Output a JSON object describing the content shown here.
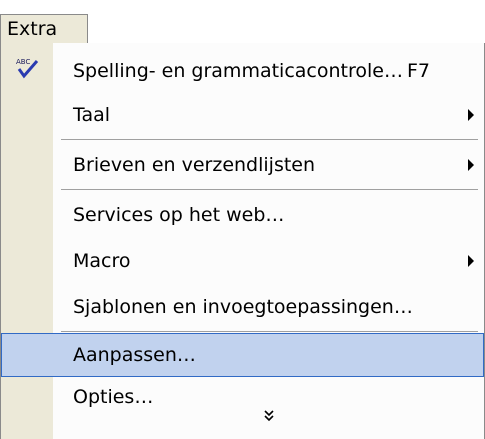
{
  "menubar": {
    "tab_label": "Extra"
  },
  "menu": {
    "items": [
      {
        "label": "Spelling- en grammaticacontrole…",
        "shortcut": "F7",
        "icon": "spellcheck-abc-icon",
        "submenu": false
      },
      {
        "label": "Taal",
        "shortcut": "",
        "submenu": true
      },
      {
        "label": "Brieven en verzendlijsten",
        "shortcut": "",
        "submenu": true
      },
      {
        "label": "Services op het web…",
        "shortcut": "",
        "submenu": false
      },
      {
        "label": "Macro",
        "shortcut": "",
        "submenu": true
      },
      {
        "label": "Sjablonen en invoegtoepassingen…",
        "shortcut": "",
        "submenu": false
      },
      {
        "label": "Aanpassen…",
        "shortcut": "",
        "submenu": false,
        "highlighted": true
      },
      {
        "label": "Opties…",
        "shortcut": "",
        "submenu": false
      }
    ],
    "expand_icon": "double-chevron-down-icon"
  },
  "colors": {
    "gutter": "#ece9d8",
    "highlight_fill": "#c1d2ee",
    "highlight_border": "#316ac5"
  }
}
